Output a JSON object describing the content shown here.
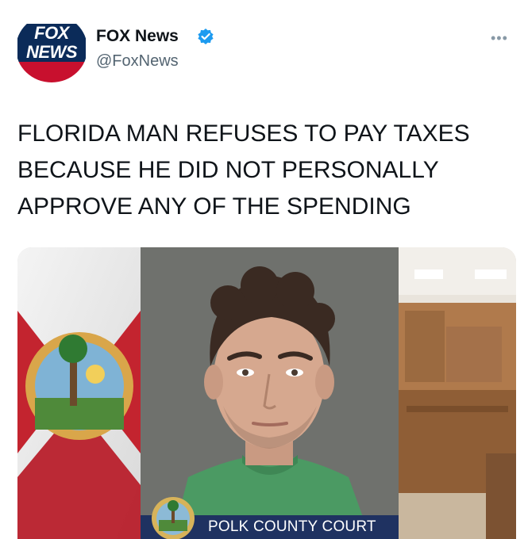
{
  "tweet": {
    "avatar": {
      "line1": "FOX",
      "line2": "NEWS",
      "icon": "fox-news-logo"
    },
    "author_name": "FOX News",
    "verified_icon": "verified-badge-icon",
    "handle": "@FoxNews",
    "more_icon": "more-options-icon",
    "more_glyph": "•••",
    "headline_lines": [
      "FLORIDA MAN REFUSES TO PAY TAXES",
      "BECAUSE HE DID NOT PERSONALLY",
      "APPROVE ANY OF THE SPENDING"
    ],
    "media": {
      "caption": "POLK COUNTY COURT",
      "panels": [
        "florida-flag",
        "mugshot",
        "courtroom"
      ]
    }
  },
  "colors": {
    "fox_blue": "#0b2b59",
    "fox_red": "#c8102e",
    "verified_blue": "#1d9bf0",
    "caption_bar": "#1f3261",
    "text": "#0f1419",
    "secondary_text": "#536471"
  }
}
